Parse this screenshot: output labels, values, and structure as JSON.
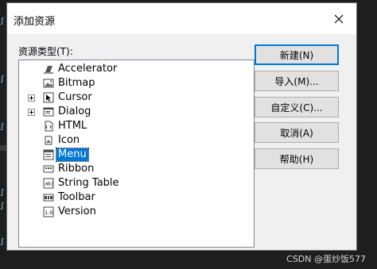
{
  "dialog": {
    "title": "添加资源",
    "list_label": "资源类型(T):"
  },
  "resource_types": [
    {
      "label": "Accelerator",
      "icon": "accelerator-icon",
      "expandable": false,
      "selected": false
    },
    {
      "label": "Bitmap",
      "icon": "bitmap-icon",
      "expandable": false,
      "selected": false
    },
    {
      "label": "Cursor",
      "icon": "cursor-icon",
      "expandable": true,
      "selected": false
    },
    {
      "label": "Dialog",
      "icon": "dialog-icon",
      "expandable": true,
      "selected": false
    },
    {
      "label": "HTML",
      "icon": "html-icon",
      "expandable": false,
      "selected": false
    },
    {
      "label": "Icon",
      "icon": "icon-resource-icon",
      "expandable": false,
      "selected": false
    },
    {
      "label": "Menu",
      "icon": "menu-icon",
      "expandable": false,
      "selected": true
    },
    {
      "label": "Ribbon",
      "icon": "ribbon-icon",
      "expandable": false,
      "selected": false
    },
    {
      "label": "String Table",
      "icon": "string-table-icon",
      "expandable": false,
      "selected": false
    },
    {
      "label": "Toolbar",
      "icon": "toolbar-icon",
      "expandable": false,
      "selected": false
    },
    {
      "label": "Version",
      "icon": "version-icon",
      "expandable": false,
      "selected": false
    }
  ],
  "buttons": {
    "new": "新建(N)",
    "import": "导入(M)...",
    "custom": "自定义(C)...",
    "cancel": "取消(A)",
    "help": "帮助(H)"
  },
  "watermark": "CSDN @蛋炒饭577",
  "colors": {
    "selection": "#0078d7",
    "default_button_border": "#0078d7",
    "dialog_background": "#f0f0f0"
  }
}
